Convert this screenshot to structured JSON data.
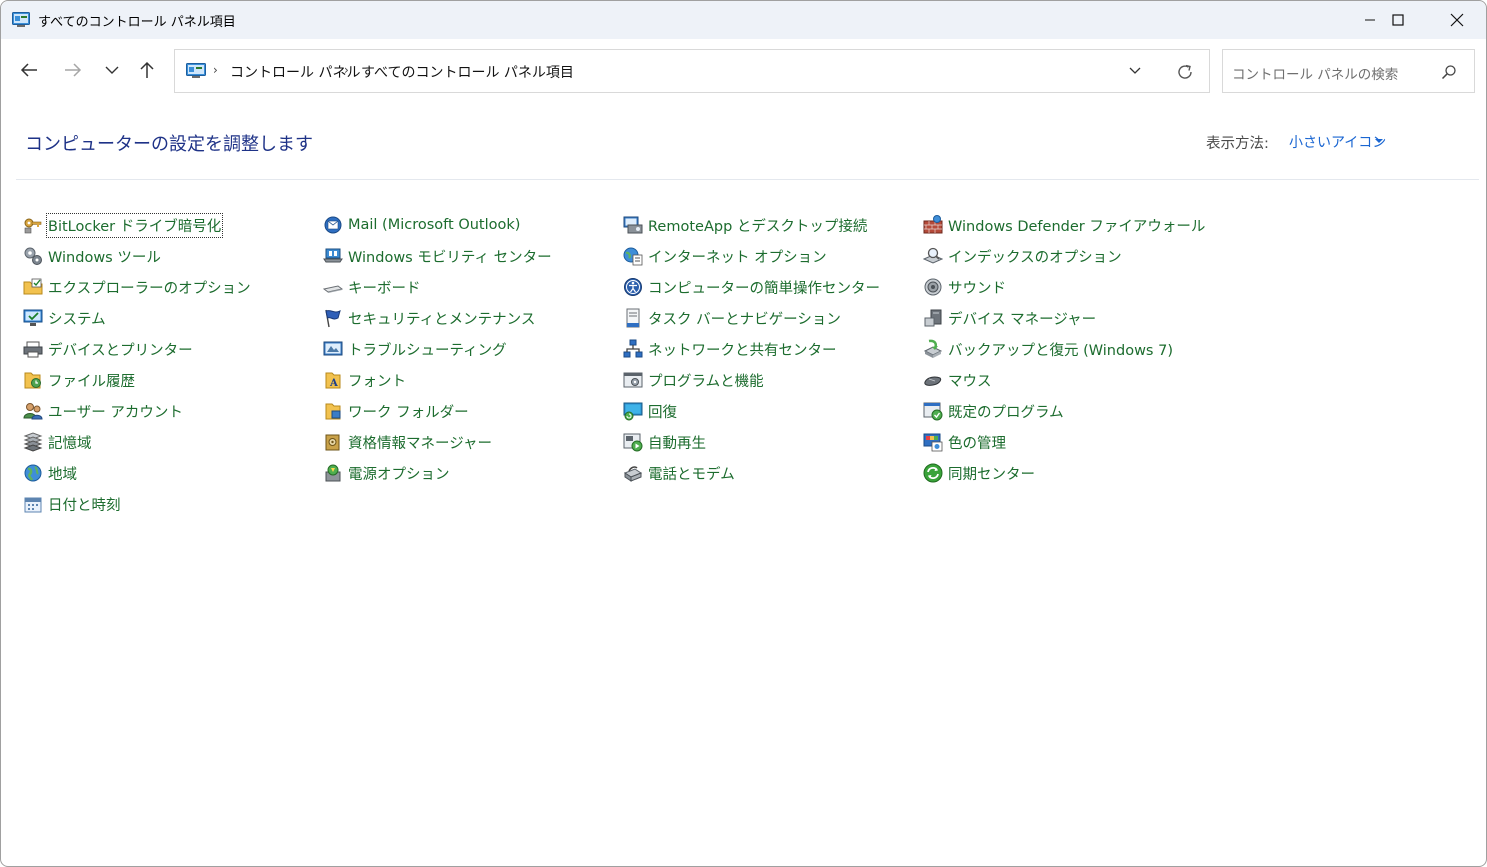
{
  "window": {
    "title": "すべてのコントロール パネル項目"
  },
  "navigation": {
    "back_icon": "arrow-left-icon",
    "forward_icon": "arrow-right-icon",
    "recent_icon": "chevron-down-icon",
    "up_icon": "arrow-up-icon"
  },
  "address": {
    "crumbs": [
      "コントロール パネル",
      "すべてのコントロール パネル項目"
    ]
  },
  "search": {
    "placeholder": "コントロール パネルの検索"
  },
  "main": {
    "heading": "コンピューターの設定を調整します",
    "view_by_label": "表示方法:",
    "view_by_value": "小さいアイコン"
  },
  "colors": {
    "link_green": "#1c6c2e",
    "heading_blue": "#1e3287",
    "accent_blue": "#1a66d2",
    "titlebar": "#eef2f8"
  },
  "items": {
    "c1": [
      {
        "label": "BitLocker ドライブ暗号化",
        "icon": "key-icon"
      },
      {
        "label": "Windows ツール",
        "icon": "gears-icon"
      },
      {
        "label": "エクスプローラーのオプション",
        "icon": "folder-options-icon"
      },
      {
        "label": "システム",
        "icon": "monitor-check-icon"
      },
      {
        "label": "デバイスとプリンター",
        "icon": "printer-icon"
      },
      {
        "label": "ファイル履歴",
        "icon": "folder-history-icon"
      },
      {
        "label": "ユーザー アカウント",
        "icon": "users-icon"
      },
      {
        "label": "記憶域",
        "icon": "storage-icon"
      },
      {
        "label": "地域",
        "icon": "globe-icon"
      },
      {
        "label": "日付と時刻",
        "icon": "calendar-icon"
      }
    ],
    "c2": [
      {
        "label": "Mail (Microsoft Outlook)",
        "icon": "mail-icon"
      },
      {
        "label": "Windows モビリティ センター",
        "icon": "mobility-icon"
      },
      {
        "label": "キーボード",
        "icon": "keyboard-icon"
      },
      {
        "label": "セキュリティとメンテナンス",
        "icon": "flag-icon"
      },
      {
        "label": "トラブルシューティング",
        "icon": "troubleshoot-icon"
      },
      {
        "label": "フォント",
        "icon": "font-folder-icon"
      },
      {
        "label": "ワーク フォルダー",
        "icon": "work-folder-icon"
      },
      {
        "label": "資格情報マネージャー",
        "icon": "vault-icon"
      },
      {
        "label": "電源オプション",
        "icon": "power-icon"
      }
    ],
    "c3": [
      {
        "label": "RemoteApp とデスクトップ接続",
        "icon": "remote-desktop-icon"
      },
      {
        "label": "インターネット オプション",
        "icon": "internet-options-icon"
      },
      {
        "label": "コンピューターの簡単操作センター",
        "icon": "accessibility-icon"
      },
      {
        "label": "タスク バーとナビゲーション",
        "icon": "taskbar-icon"
      },
      {
        "label": "ネットワークと共有センター",
        "icon": "network-icon"
      },
      {
        "label": "プログラムと機能",
        "icon": "programs-icon"
      },
      {
        "label": "回復",
        "icon": "recovery-icon"
      },
      {
        "label": "自動再生",
        "icon": "autoplay-icon"
      },
      {
        "label": "電話とモデム",
        "icon": "phone-modem-icon"
      }
    ],
    "c4": [
      {
        "label": "Windows Defender ファイアウォール",
        "icon": "firewall-icon"
      },
      {
        "label": "インデックスのオプション",
        "icon": "indexing-icon"
      },
      {
        "label": "サウンド",
        "icon": "speaker-icon"
      },
      {
        "label": "デバイス マネージャー",
        "icon": "device-manager-icon"
      },
      {
        "label": "バックアップと復元 (Windows 7)",
        "icon": "backup-icon"
      },
      {
        "label": "マウス",
        "icon": "mouse-icon"
      },
      {
        "label": "既定のプログラム",
        "icon": "default-programs-icon"
      },
      {
        "label": "色の管理",
        "icon": "color-management-icon"
      },
      {
        "label": "同期センター",
        "icon": "sync-icon"
      }
    ]
  }
}
